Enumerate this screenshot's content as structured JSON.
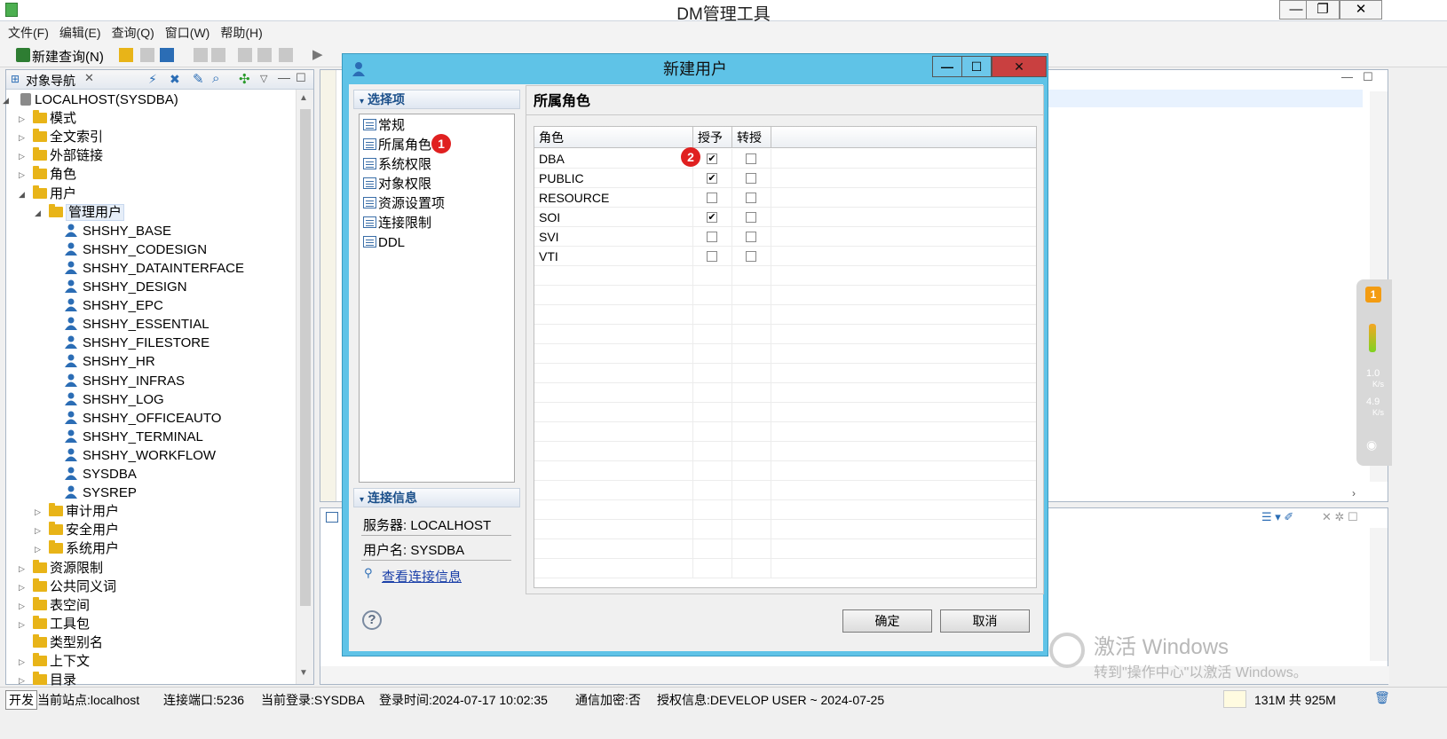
{
  "app": {
    "title": "DM管理工具"
  },
  "menu": [
    "文件(F)",
    "编辑(E)",
    "查询(Q)",
    "窗口(W)",
    "帮助(H)"
  ],
  "toolbar": {
    "new_query": "新建查询(N)"
  },
  "nav": {
    "tab": "对象导航",
    "root": "LOCALHOST(SYSDBA)",
    "items": [
      "模式",
      "全文索引",
      "外部链接",
      "角色",
      "用户"
    ],
    "manage_users": "管理用户",
    "users": [
      "SHSHY_BASE",
      "SHSHY_CODESIGN",
      "SHSHY_DATAINTERFACE",
      "SHSHY_DESIGN",
      "SHSHY_EPC",
      "SHSHY_ESSENTIAL",
      "SHSHY_FILESTORE",
      "SHSHY_HR",
      "SHSHY_INFRAS",
      "SHSHY_LOG",
      "SHSHY_OFFICEAUTO",
      "SHSHY_TERMINAL",
      "SHSHY_WORKFLOW",
      "SYSDBA",
      "SYSREP"
    ],
    "sub_users": [
      "审计用户",
      "安全用户",
      "系统用户"
    ],
    "items2": [
      "资源限制",
      "公共同义词",
      "表空间",
      "工具包",
      "类型别名",
      "上下文",
      "目录"
    ]
  },
  "dialog": {
    "title": "新建用户",
    "section_select": "选择项",
    "menu": [
      "常规",
      "所属角色",
      "系统权限",
      "对象权限",
      "资源设置项",
      "连接限制",
      "DDL"
    ],
    "badge1": "1",
    "badge2": "2",
    "section_conn": "连接信息",
    "server": "服务器: LOCALHOST",
    "username": "用户名: SYSDBA",
    "view_conn": "查看连接信息",
    "panel_title": "所属角色",
    "columns": [
      "角色",
      "授予",
      "转授"
    ],
    "roles": [
      {
        "name": "DBA",
        "grant": "✔",
        "delegate": ""
      },
      {
        "name": "PUBLIC",
        "grant": "✔",
        "delegate": ""
      },
      {
        "name": "RESOURCE",
        "grant": "",
        "delegate": ""
      },
      {
        "name": "SOI",
        "grant": "✔",
        "delegate": ""
      },
      {
        "name": "SVI",
        "grant": "",
        "delegate": ""
      },
      {
        "name": "VTI",
        "grant": "",
        "delegate": ""
      }
    ],
    "ok": "确定",
    "cancel": "取消",
    "help": "?"
  },
  "status": {
    "mode": "开发",
    "site": "当前站点:localhost",
    "port": "连接端口:5236",
    "login": "当前登录:SYSDBA",
    "login_time": "登录时间:2024-07-17 10:02:35",
    "encrypt": "通信加密:否",
    "license": "授权信息:DEVELOP USER ~ 2024-07-25",
    "memory": "131M 共 925M"
  },
  "widget": {
    "badge": "1",
    "up": "1.0",
    "up_unit": "K/s",
    "down": "4.9",
    "down_unit": "K/s"
  },
  "watermark": {
    "line1": "激活 Windows",
    "line2": "转到\"操作中心\"以激活 Windows。"
  }
}
